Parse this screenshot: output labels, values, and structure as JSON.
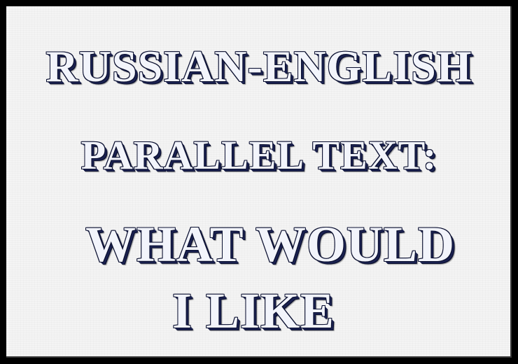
{
  "title": {
    "line1": "RUSSIAN-ENGLISH",
    "line2": "PARALLEL TEXT:",
    "line3": "WHAT WOULD",
    "line4": "I LIKE"
  },
  "colors": {
    "background": "#f4f4f4",
    "border": "#000000",
    "text_outline": "#0b1030",
    "text_fill": "#f2f4fb"
  }
}
